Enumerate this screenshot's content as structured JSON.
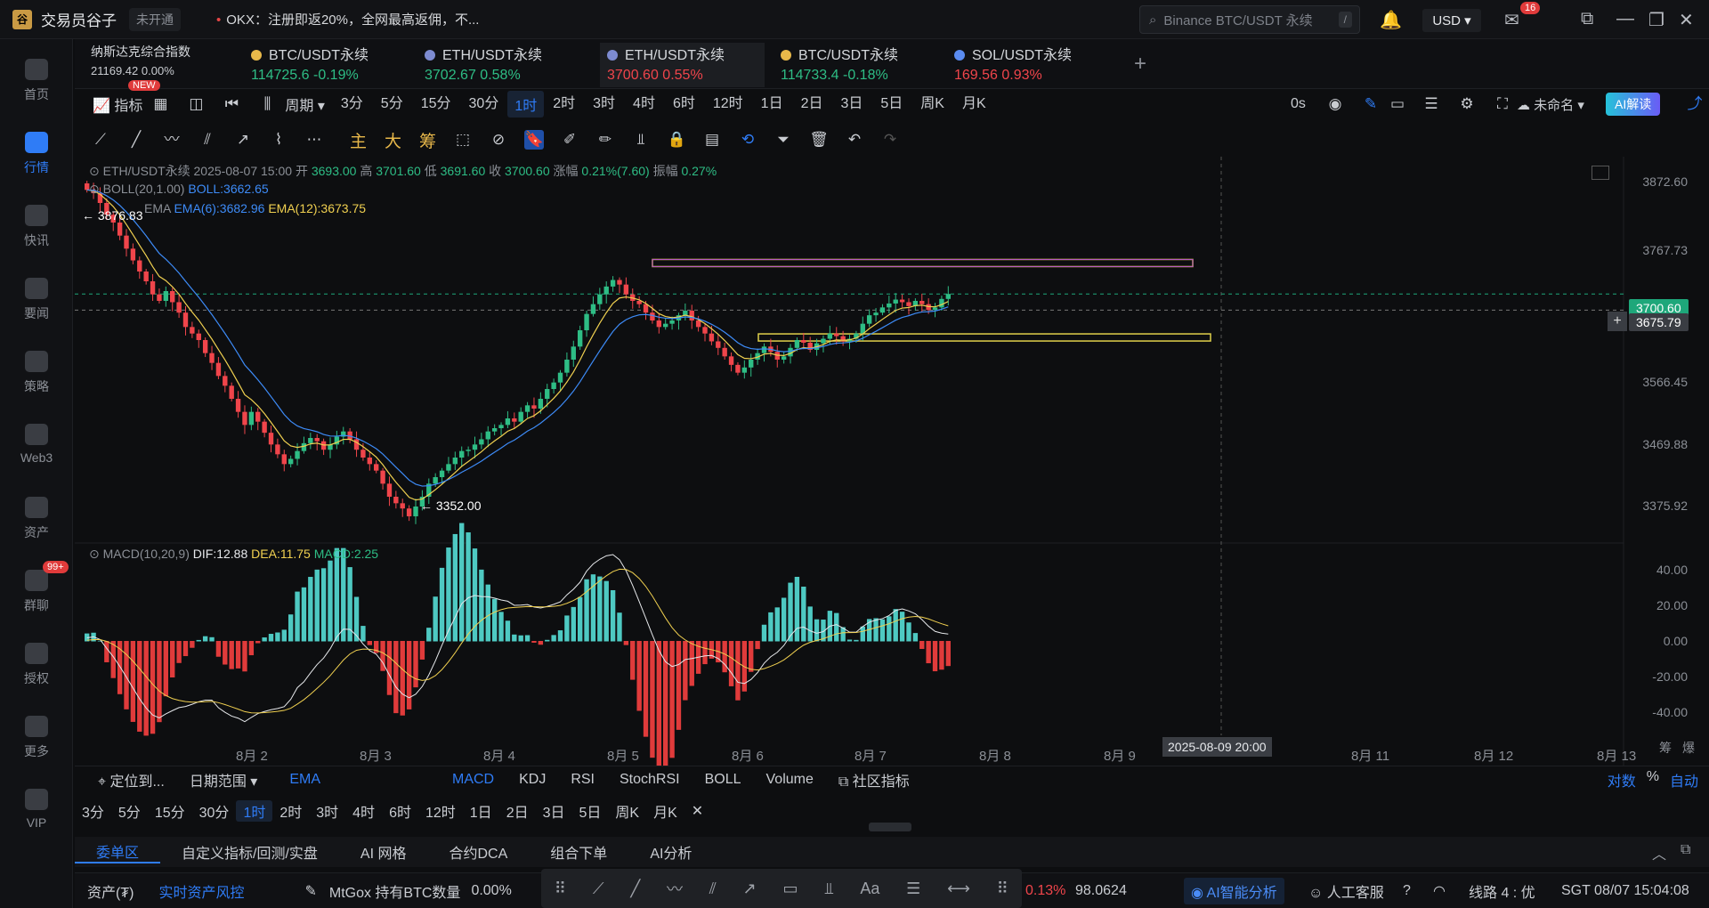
{
  "app": {
    "title": "交易员谷子",
    "status": "未开通",
    "ad": "OKX：注册即返20%，全网最高返佣，不..."
  },
  "search": {
    "placeholder": "Binance BTC/USDT 永续",
    "shortcut": "/"
  },
  "currency": "USD",
  "mail_count": "16",
  "sidebar": [
    {
      "label": "首页",
      "icon": "home-icon"
    },
    {
      "label": "行情",
      "icon": "market-icon"
    },
    {
      "label": "快讯",
      "icon": "news-icon"
    },
    {
      "label": "要闻",
      "icon": "headlines-icon"
    },
    {
      "label": "策略",
      "icon": "strategy-icon"
    },
    {
      "label": "Web3",
      "icon": "web3-icon"
    },
    {
      "label": "资产",
      "icon": "wallet-icon"
    },
    {
      "label": "群聊",
      "icon": "chat-icon",
      "badge": "99+"
    },
    {
      "label": "授权",
      "icon": "key-icon"
    },
    {
      "label": "更多",
      "icon": "more-icon"
    },
    {
      "label": "VIP",
      "icon": "vip-icon"
    }
  ],
  "tabs": [
    {
      "name": "纳斯达克综合指数",
      "price": "21169.42",
      "change": "0.00%",
      "tag": "NEW",
      "color": "#c9ccd1"
    },
    {
      "name": "BTC/USDT永续",
      "price": "114725.6",
      "change": "-0.19%",
      "color": "#2ebd85"
    },
    {
      "name": "ETH/USDT永续",
      "price": "3702.67",
      "change": "0.58%",
      "color": "#2ebd85"
    },
    {
      "name": "ETH/USDT永续",
      "price": "3700.60",
      "change": "0.55%",
      "color": "#f0454b"
    },
    {
      "name": "BTC/USDT永续",
      "price": "114733.4",
      "change": "-0.18%",
      "color": "#2ebd85"
    },
    {
      "name": "SOL/USDT永续",
      "price": "169.56",
      "change": "0.93%",
      "color": "#f0454b"
    }
  ],
  "toolbar": {
    "indicator": "指标",
    "period": "周期",
    "intervals": [
      "3分",
      "5分",
      "15分",
      "30分",
      "1时",
      "2时",
      "3时",
      "4时",
      "6时",
      "12时",
      "1日",
      "2日",
      "3日",
      "5日",
      "周K",
      "月K"
    ],
    "selected": "1时",
    "countdown": "0s",
    "layout": "未命名",
    "ai": "AI解读"
  },
  "drawtools": [
    "主",
    "大",
    "筹"
  ],
  "chart_info": {
    "symbol": "ETH/USDT永续",
    "time": "2025-08-07 15:00",
    "open_l": "开",
    "open": "3693.00",
    "high_l": "高",
    "high": "3701.60",
    "low_l": "低",
    "low": "3691.60",
    "close_l": "收",
    "close": "3700.60",
    "chg_l": "涨幅",
    "chg": "0.21%(7.60)",
    "amp_l": "振幅",
    "amp": "0.27%"
  },
  "boll": {
    "label": "BOLL(20,1.00)",
    "value": "BOLL:3662.65"
  },
  "ema": {
    "label": "EMA",
    "e6": "EMA(6):3682.96",
    "e12": "EMA(12):3673.75"
  },
  "macd": {
    "label": "MACD(10,20,9)",
    "dif": "DIF:12.88",
    "dea": "DEA:11.75",
    "macd": "MACD:2.25"
  },
  "price_axis": [
    "3872.60",
    "3767.73",
    "3700.60",
    "3675.79",
    "3566.45",
    "3469.88",
    "3375.92"
  ],
  "macd_axis": [
    "40.00",
    "20.00",
    "0.00",
    "-20.00",
    "-40.00"
  ],
  "time_axis": [
    "8月 2",
    "8月 3",
    "8月 4",
    "8月 5",
    "8月 6",
    "8月 7",
    "8月 8",
    "8月 9",
    "2025-08-09 20:00",
    "8月 11",
    "8月 12",
    "8月 13"
  ],
  "axis_right": [
    "筹",
    "爆"
  ],
  "markers": {
    "high": "← 3876.83",
    "low": "← 3352.00"
  },
  "bottom_bar": {
    "locate": "定位到...",
    "range": "日期范围",
    "ema": "EMA",
    "indicators": [
      "MACD",
      "KDJ",
      "RSI",
      "StochRSI",
      "BOLL",
      "Volume"
    ],
    "community": "社区指标",
    "right": [
      "对数",
      "%",
      "自动"
    ]
  },
  "bottom_intervals": [
    "3分",
    "5分",
    "15分",
    "30分",
    "1时",
    "2时",
    "3时",
    "4时",
    "6时",
    "12时",
    "1日",
    "2日",
    "3日",
    "5日",
    "周K",
    "月K"
  ],
  "panel_tabs": [
    "委单区",
    "自定义指标/回测/实盘",
    "AI 网格",
    "合约DCA",
    "组合下单",
    "AI分析"
  ],
  "status": {
    "assets": "资产(₮)",
    "risk": "实时资产风控",
    "mtgox": "MtGox 持有BTC数量",
    "mtgox_v": "0.00%",
    "pct": "0.13%",
    "val": "98.0624",
    "ai": "AI智能分析",
    "cs": "人工客服",
    "line": "线路 4 : 优",
    "time": "SGT 08/07 15:04:08"
  },
  "chart_data": {
    "type": "candlestick",
    "symbol": "ETH/USDT永续",
    "interval": "1时",
    "high": 3876.83,
    "low": 3352.0,
    "last": 3700.6,
    "crosshair": 3675.79,
    "ylim": [
      3330,
      3900
    ],
    "closes": [
      3860,
      3855,
      3840,
      3822,
      3810,
      3790,
      3770,
      3752,
      3735,
      3720,
      3700,
      3690,
      3705,
      3688,
      3672,
      3650,
      3640,
      3630,
      3610,
      3595,
      3575,
      3560,
      3540,
      3520,
      3500,
      3520,
      3505,
      3488,
      3470,
      3455,
      3440,
      3448,
      3460,
      3472,
      3480,
      3475,
      3462,
      3470,
      3482,
      3490,
      3478,
      3462,
      3450,
      3440,
      3430,
      3410,
      3390,
      3380,
      3372,
      3360,
      3375,
      3390,
      3410,
      3420,
      3430,
      3440,
      3450,
      3460,
      3462,
      3470,
      3478,
      3490,
      3495,
      3500,
      3510,
      3505,
      3520,
      3530,
      3525,
      3540,
      3555,
      3565,
      3580,
      3600,
      3620,
      3645,
      3670,
      3685,
      3700,
      3712,
      3722,
      3715,
      3700,
      3690,
      3685,
      3672,
      3660,
      3650,
      3655,
      3660,
      3668,
      3675,
      3660,
      3650,
      3640,
      3628,
      3618,
      3605,
      3592,
      3580,
      3588,
      3600,
      3610,
      3620,
      3612,
      3600,
      3605,
      3618,
      3630,
      3626,
      3615,
      3625,
      3632,
      3640,
      3636,
      3628,
      3632,
      3640,
      3655,
      3668,
      3672,
      3680,
      3686,
      3692,
      3688,
      3682,
      3690,
      3685,
      3676,
      3680,
      3693,
      3700.6
    ]
  }
}
